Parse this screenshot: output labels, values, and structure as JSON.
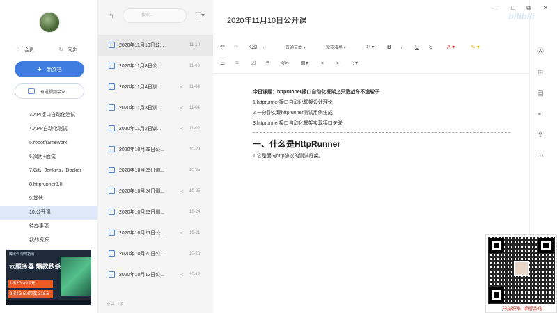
{
  "sidebar": {
    "member_label": "会员",
    "sync_label": "同步",
    "new_doc_label": "新文档",
    "meeting_label": "有道视频会议",
    "folders": [
      {
        "label": "3.API接口自动化测试"
      },
      {
        "label": "4.APP自动化测试"
      },
      {
        "label": "5.robotframework"
      },
      {
        "label": "6.简历+面试"
      },
      {
        "label": "7.Git，Jenkins，Docker"
      },
      {
        "label": "8.httprunner3.0"
      },
      {
        "label": "9.其他"
      },
      {
        "label": "10.公开课"
      },
      {
        "label": "待办事项"
      },
      {
        "label": "我的资源"
      }
    ],
    "ad": {
      "top": "腾讯云 限时抢购",
      "title": "云服务器 爆款秒杀",
      "line1": "1核2G 89.9元",
      "line2": "2核4G 5M带宽 318.6元"
    }
  },
  "list": {
    "search_placeholder": "搜索...",
    "count_label": "总共12项",
    "items": [
      {
        "title": "2020年11月10日公...",
        "date": "11-10"
      },
      {
        "title": "2020年11月8日公...",
        "date": "11-08"
      },
      {
        "title": "2020年11月4日训...",
        "date": "11-04"
      },
      {
        "title": "2020年11月3日训...",
        "date": "11-04"
      },
      {
        "title": "2020年11月2日训...",
        "date": "11-02"
      },
      {
        "title": "2020年10月29日公...",
        "date": "10-29"
      },
      {
        "title": "2020年10月25日训...",
        "date": "10-25"
      },
      {
        "title": "2020年10月24日训...",
        "date": "10-25"
      },
      {
        "title": "2020年10月23日训...",
        "date": "10-24"
      },
      {
        "title": "2020年10月21日公...",
        "date": "10-21"
      },
      {
        "title": "2020年10月20日公...",
        "date": "10-20"
      },
      {
        "title": "2020年10月12日公...",
        "date": "10-12"
      }
    ]
  },
  "editor": {
    "title": "2020年11月10日公开课",
    "toolbar": {
      "paragraph_style": "普通文本",
      "font": "微软雅黑",
      "font_size": "14"
    },
    "content": {
      "topic": "今日课题：httprunner接口自动化框架之只造战车不造轮子",
      "item1": "1.httprunner接口自动化框架设计理论",
      "item2": "2.一分钟实现httprunner测试用例生成",
      "item3": "3.httprunner接口自动化框架实现接口关联",
      "heading": "一、什么是HttpRunner",
      "line": "1.它是面向http协议的测试框架。"
    }
  },
  "overlay": {
    "logo": "bilibili",
    "qr_caption": "扫描获取 课程咨询"
  },
  "colors": {
    "accent": "#3f7de0",
    "active_folder_bg": "#dde8f8"
  }
}
